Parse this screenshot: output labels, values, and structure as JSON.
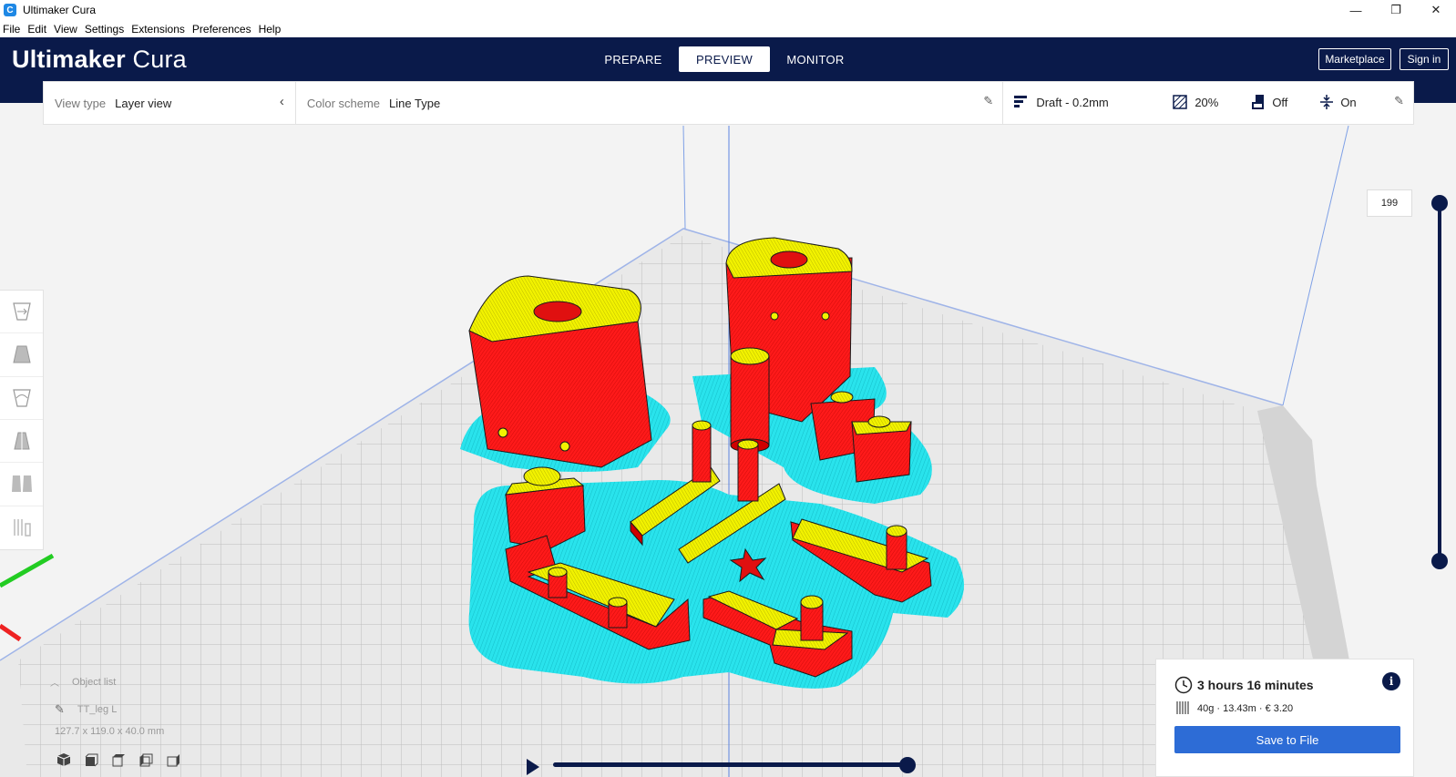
{
  "window": {
    "title": "Ultimaker Cura",
    "app_icon": "cura-logo-icon",
    "controls": [
      "—",
      "❐",
      "✕"
    ]
  },
  "menu": {
    "items": [
      "File",
      "Edit",
      "View",
      "Settings",
      "Extensions",
      "Preferences",
      "Help"
    ]
  },
  "header": {
    "brand_bold": "Ultimaker",
    "brand_light": " Cura",
    "tabs": [
      {
        "label": "PREPARE"
      },
      {
        "label": "PREVIEW"
      },
      {
        "label": "MONITOR"
      }
    ],
    "active_tab": "PREVIEW",
    "marketplace_label": "Marketplace",
    "signin_label": "Sign in",
    "colors": {
      "header_bg": "#0a1a4a",
      "accent": "#2d6cd6"
    }
  },
  "settings_bar": {
    "view_type_label": "View type",
    "view_type_value": "Layer view",
    "color_scheme_label": "Color scheme",
    "color_scheme_value": "Line Type",
    "profile": "Draft - 0.2mm",
    "infill": "20%",
    "support": "Off",
    "adhesion": "On"
  },
  "layer_slider": {
    "current_layer": "199"
  },
  "object_list": {
    "toggle_label": "Object list",
    "object_name": "TT_leg L",
    "dimensions": "127.7 x 119.0 x 40.0 mm"
  },
  "print_info": {
    "time": "3 hours 16 minutes",
    "material": "40g · 13.43m · € 3.20",
    "info_icon": "i",
    "save_label": "Save to File"
  }
}
